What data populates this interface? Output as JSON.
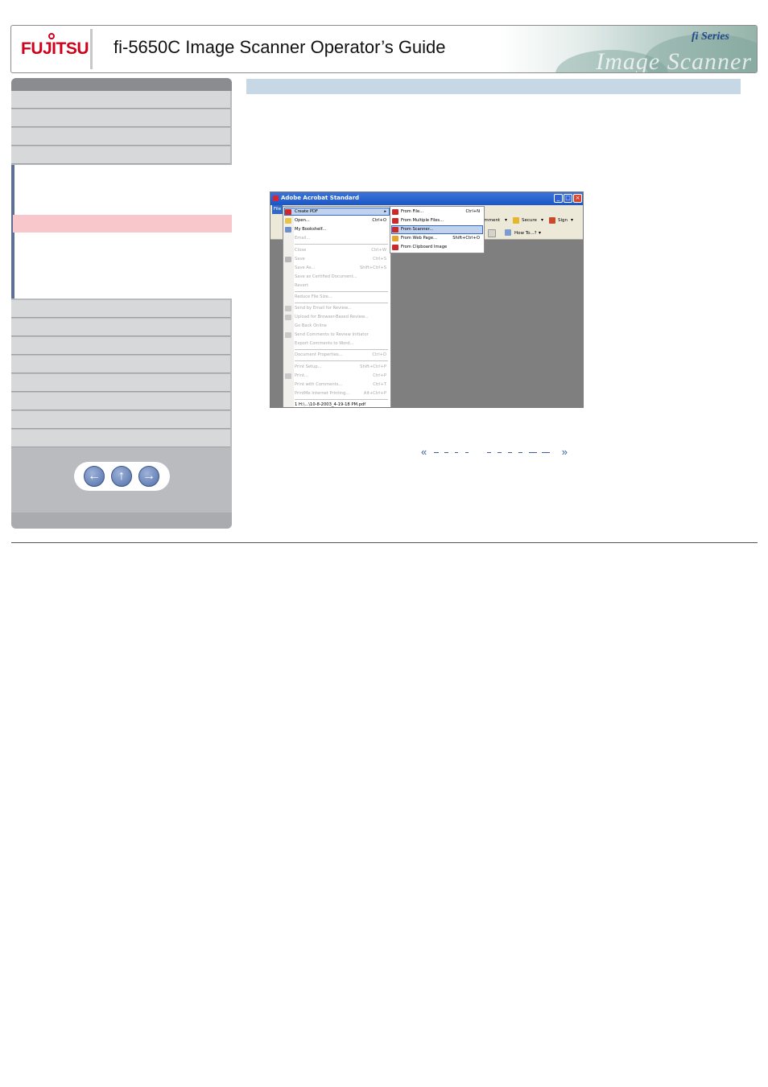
{
  "header": {
    "brand": "FUJITSU",
    "title": "fi-5650C Image Scanner Operator’s Guide",
    "series_logo": "fi Series",
    "banner_word": "Image Scanner"
  },
  "sidebar": {
    "nav_buttons": {
      "back": "←",
      "up": "↑",
      "forward": "→"
    }
  },
  "screenshot": {
    "window_title": "Adobe Acrobat Standard",
    "menu_file": "File",
    "toolbar": {
      "comment": "omment",
      "secure": "Secure",
      "sign": "Sign",
      "how_to": "How To...?"
    },
    "file_menu": [
      {
        "label": "Create PDF",
        "shortcut": "",
        "disabled": false
      },
      {
        "label": "Open...",
        "shortcut": "Ctrl+O",
        "disabled": false
      },
      {
        "label": "My Bookshelf...",
        "shortcut": "",
        "disabled": false
      },
      {
        "label": "Email...",
        "shortcut": "",
        "disabled": true
      },
      {
        "label": "Close",
        "shortcut": "Ctrl+W",
        "disabled": true
      },
      {
        "label": "Save",
        "shortcut": "Ctrl+S",
        "disabled": true
      },
      {
        "label": "Save As...",
        "shortcut": "Shift+Ctrl+S",
        "disabled": true
      },
      {
        "label": "Save as Certified Document...",
        "shortcut": "",
        "disabled": true
      },
      {
        "label": "Revert",
        "shortcut": "",
        "disabled": true
      },
      {
        "label": "Reduce File Size...",
        "shortcut": "",
        "disabled": true
      },
      {
        "label": "Send by Email for Review...",
        "shortcut": "",
        "disabled": true
      },
      {
        "label": "Upload for Browser-Based Review...",
        "shortcut": "",
        "disabled": true
      },
      {
        "label": "Go Back Online",
        "shortcut": "",
        "disabled": true
      },
      {
        "label": "Send Comments to Review Initiator",
        "shortcut": "",
        "disabled": true
      },
      {
        "label": "Export Comments to Word...",
        "shortcut": "",
        "disabled": true
      },
      {
        "label": "Document Properties...",
        "shortcut": "Ctrl+D",
        "disabled": true
      },
      {
        "label": "Print Setup...",
        "shortcut": "Shift+Ctrl+P",
        "disabled": true
      },
      {
        "label": "Print...",
        "shortcut": "Ctrl+P",
        "disabled": true
      },
      {
        "label": "Print with Comments...",
        "shortcut": "Ctrl+T",
        "disabled": true
      },
      {
        "label": "PrintMe Internet Printing...",
        "shortcut": "Alt+Ctrl+P",
        "disabled": true
      },
      {
        "label": "1 H:\\...\\10-8-2003_4-19-18 PM.pdf",
        "shortcut": "",
        "disabled": false
      }
    ],
    "sub_menu": [
      {
        "label": "From File...",
        "shortcut": "Ctrl+N"
      },
      {
        "label": "From Multiple Files...",
        "shortcut": ""
      },
      {
        "label": "From Scanner...",
        "shortcut": ""
      },
      {
        "label": "From Web Page...",
        "shortcut": "Shift+Ctrl+O"
      },
      {
        "label": "From Clipboard Image",
        "shortcut": ""
      }
    ]
  },
  "pager": {
    "prev": "«",
    "next": "»"
  }
}
